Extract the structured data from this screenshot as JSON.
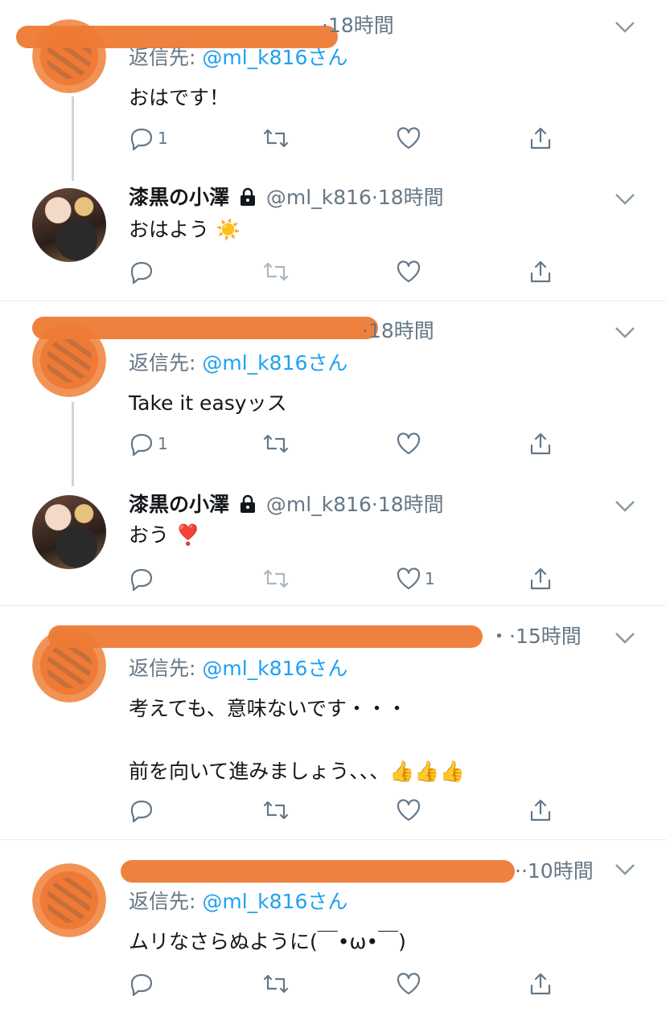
{
  "tweets": [
    {
      "kind": "reply",
      "time_sep": "·",
      "time": "18時間",
      "reply_to_label": "返信先: ",
      "mention": "@ml_k816さん",
      "text": "おはです！",
      "reply_count": "1",
      "like_count": ""
    },
    {
      "kind": "self",
      "name": "漆黒の小澤",
      "handle": "@ml_k816",
      "time_sep": "·",
      "time": "18時間",
      "text": "おはよう ☀️",
      "reply_count": "",
      "like_count": ""
    },
    {
      "kind": "reply",
      "time_sep": "·",
      "time": "18時間",
      "reply_to_label": "返信先: ",
      "mention": "@ml_k816さん",
      "text": "Take it easyッス",
      "reply_count": "1",
      "like_count": ""
    },
    {
      "kind": "self",
      "name": "漆黒の小澤",
      "handle": "@ml_k816",
      "time_sep": "·",
      "time": "18時間",
      "text": "おう ❣️",
      "reply_count": "",
      "like_count": "1"
    },
    {
      "kind": "reply",
      "time_sep": "・·",
      "time": "15時間",
      "reply_to_label": "返信先: ",
      "mention": "@ml_k816さん",
      "text_line1": "考えても、意味ないです・・・",
      "text_line2": "前を向いて進みましょう、、、👍👍👍",
      "reply_count": "",
      "like_count": ""
    },
    {
      "kind": "reply",
      "time_sep": "··",
      "time": "10時間",
      "reply_to_label": "返信先: ",
      "mention": "@ml_k816さん",
      "text": "ムリなさらぬように(￣•ω•￣)",
      "reply_count": "",
      "like_count": ""
    }
  ],
  "icons": [
    "reply-icon",
    "retweet-icon",
    "like-icon",
    "share-icon",
    "chevron-down-icon",
    "lock-icon"
  ],
  "colors": {
    "mention": "#1da1f2",
    "secondary_text": "#657786",
    "redaction": "#ee7a35"
  }
}
